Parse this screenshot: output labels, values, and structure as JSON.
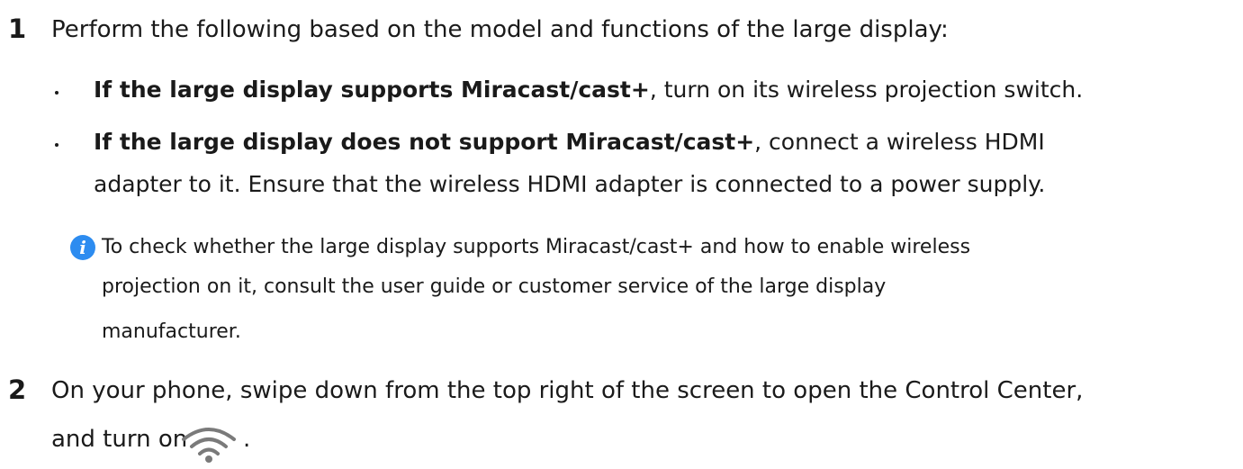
{
  "steps": [
    {
      "number": "1",
      "text": "Perform the following based on the model and functions of the large display:",
      "bullets": [
        {
          "bold": "If the large display supports Miracast/cast+",
          "rest": ", turn on its wireless projection switch."
        },
        {
          "bold": "If the large display does not support Miracast/cast+",
          "rest": ", connect a wireless HDMI",
          "continuation": "adapter to it. Ensure that the wireless HDMI adapter is connected to a power supply."
        }
      ],
      "note": {
        "icon": "info-icon",
        "line1": "To check whether the large display supports Miracast/cast+ and how to enable wireless",
        "line2": "projection on it, consult the user guide or customer service of the large display",
        "line3": "manufacturer."
      }
    },
    {
      "number": "2",
      "line1": "On your phone, swipe down from the top right of the screen to open the Control Center,",
      "line2_prefix": "and turn on",
      "line2_suffix": ".",
      "icon": "wifi-icon"
    }
  ],
  "colors": {
    "text": "#1a1a1a",
    "info_icon": "#2d8cf0",
    "wifi_icon": "#7a7a7a"
  }
}
